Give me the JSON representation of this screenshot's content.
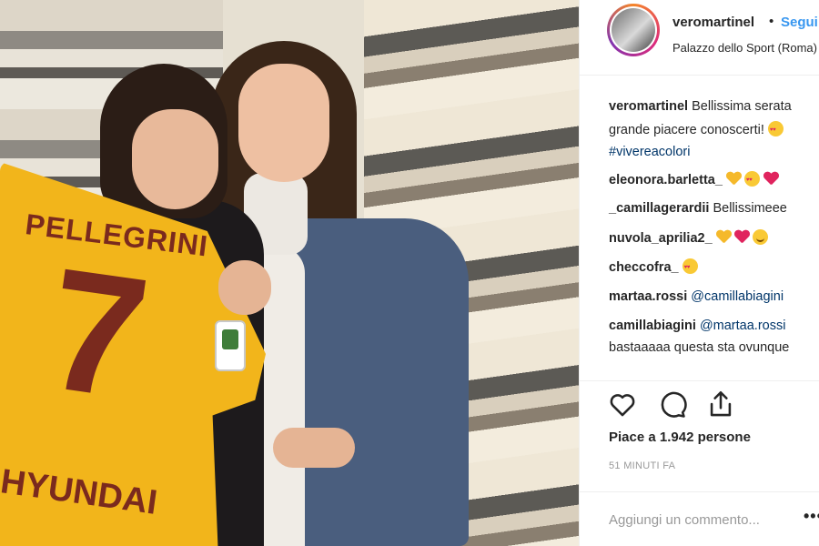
{
  "post": {
    "username": "veromartinel",
    "separator": "•",
    "follow_label": "Segui",
    "location": "Palazzo dello Sport (Roma)"
  },
  "photo": {
    "jersey_name": "PELLEGRINI",
    "jersey_number": "7",
    "jersey_sponsor": "HYUNDAI"
  },
  "caption": {
    "username": "veromartinel",
    "line1": "Bellissima serata",
    "line2": "grande piacere conoscerti!",
    "hashtag": "#vivereacolori"
  },
  "comments": [
    {
      "username": "eleonora.barletta_",
      "text": ""
    },
    {
      "username": "_camillagerardii",
      "text": "Bellissimeee"
    },
    {
      "username": "nuvola_aprilia2_",
      "text": ""
    },
    {
      "username": "checcofra_",
      "text": ""
    },
    {
      "username": "martaa.rossi",
      "text": "@camillabiagini"
    },
    {
      "username": "camillabiagini",
      "text": "@martaa.rossi",
      "text2": "bastaaaaa questa sta ovunque"
    }
  ],
  "likes_text": "Piace a 1.942 persone",
  "time_text": "51 MINUTI FA",
  "add_comment_placeholder": "Aggiungi un commento...",
  "more_label": "•••",
  "icons": {
    "like": "heart-outline-icon",
    "comment": "comment-bubble-icon",
    "share": "share-icon"
  },
  "colors": {
    "accent": "#3897f0",
    "hashtag": "#003569",
    "muted": "#999999"
  }
}
